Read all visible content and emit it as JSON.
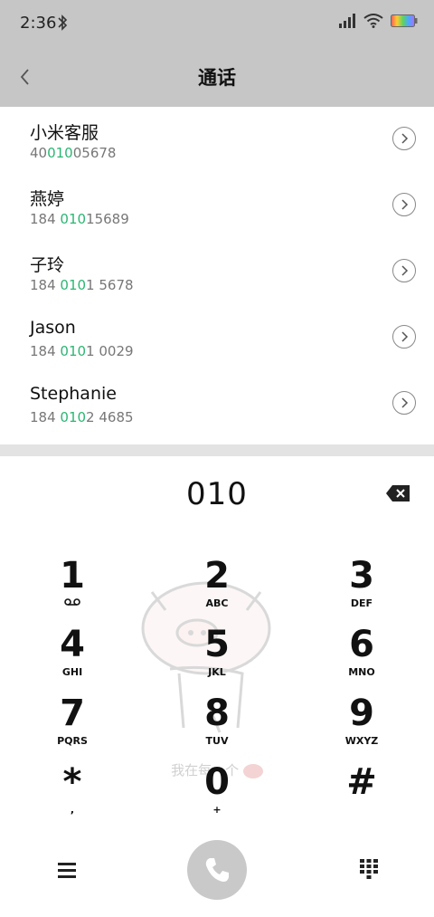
{
  "status": {
    "time": "2:36"
  },
  "header": {
    "title": "通话"
  },
  "contacts": [
    {
      "name": "小米客服",
      "pre": "40",
      "match": "010",
      "post": "05678"
    },
    {
      "name": "燕婷",
      "pre": "184 ",
      "match": "010",
      "post": "15689"
    },
    {
      "name": "子玲",
      "pre": "184 ",
      "match": "010",
      "post": "1 5678"
    },
    {
      "name": "Jason",
      "pre": "184 ",
      "match": "010",
      "post": "1 0029"
    },
    {
      "name": "Stephanie",
      "pre": "184 ",
      "match": "010",
      "post": "2 4685"
    }
  ],
  "dialpad": {
    "input": "010",
    "watermark": "我在每一个",
    "keys": [
      {
        "digit": "1",
        "letters": ""
      },
      {
        "digit": "2",
        "letters": "ABC"
      },
      {
        "digit": "3",
        "letters": "DEF"
      },
      {
        "digit": "4",
        "letters": "GHI"
      },
      {
        "digit": "5",
        "letters": "JKL"
      },
      {
        "digit": "6",
        "letters": "MNO"
      },
      {
        "digit": "7",
        "letters": "PQRS"
      },
      {
        "digit": "8",
        "letters": "TUV"
      },
      {
        "digit": "9",
        "letters": "WXYZ"
      },
      {
        "digit": "*",
        "letters": ","
      },
      {
        "digit": "0",
        "letters": "+"
      },
      {
        "digit": "#",
        "letters": ""
      }
    ]
  },
  "icons": {
    "bluetooth": "bluetooth-icon",
    "signal": "signal-icon",
    "wifi": "wifi-icon",
    "battery": "battery-icon",
    "back": "back-arrow-icon",
    "contact_detail": "chevron-right-circle-icon",
    "backspace": "backspace-icon",
    "voicemail": "voicemail-icon",
    "menu": "menu-icon",
    "call": "phone-icon",
    "dialpad_toggle": "dialpad-icon"
  },
  "colors": {
    "match_highlight": "#2bb673",
    "header_bg": "#c6c6c6",
    "call_button": "#c9c9c9"
  }
}
